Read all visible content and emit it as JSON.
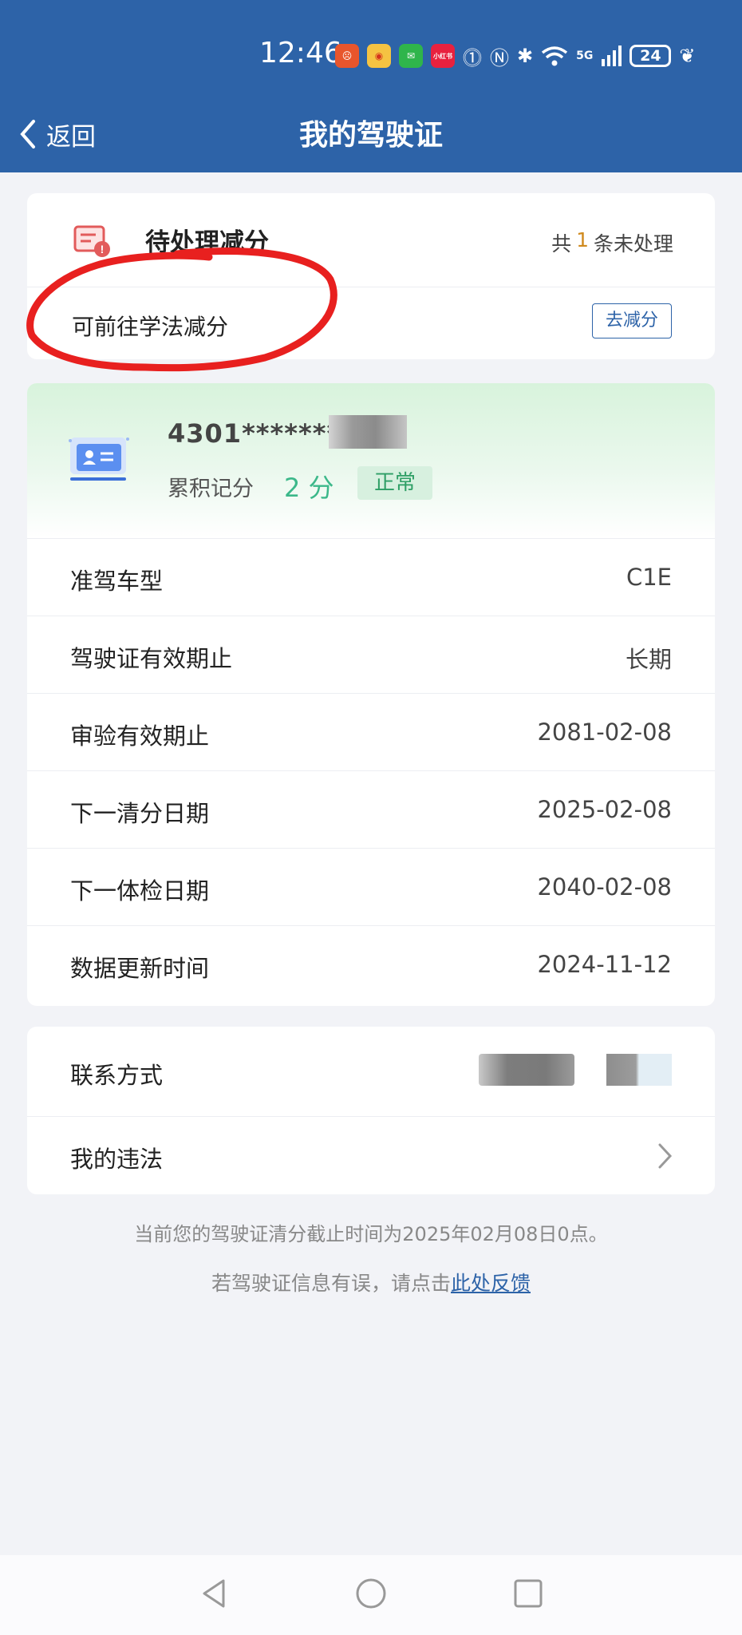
{
  "status_bar": {
    "time": "12:46",
    "app_icons": [
      "weather-app",
      "weibo-app",
      "wechat-app",
      "xiaohongshu-app"
    ],
    "xiaohongshu_text": "小红书",
    "indicators": [
      "hd-icon",
      "nfc-icon",
      "bluetooth-icon",
      "wifi-icon"
    ],
    "network": "5G",
    "battery": "24"
  },
  "nav": {
    "back_label": "返回",
    "title": "我的驾驶证"
  },
  "pending": {
    "title": "待处理减分",
    "summary_prefix": "共",
    "summary_count": "1",
    "summary_suffix": "条未处理",
    "hint": "可前往学法减分",
    "action_label": "去减分"
  },
  "license": {
    "number_masked": "4301********",
    "points_label": "累积记分",
    "points_value": "2 分",
    "status": "正常",
    "rows": [
      {
        "label": "准驾车型",
        "value": "C1E"
      },
      {
        "label": "驾驶证有效期止",
        "value": "长期"
      },
      {
        "label": "审验有效期止",
        "value": "2081-02-08"
      },
      {
        "label": "下一清分日期",
        "value": "2025-02-08"
      },
      {
        "label": "下一体检日期",
        "value": "2040-02-08"
      },
      {
        "label": "数据更新时间",
        "value": "2024-11-12"
      }
    ]
  },
  "contact": {
    "label": "联系方式",
    "violation_label": "我的违法"
  },
  "footer": {
    "note": "当前您的驾驶证清分截止时间为2025年02月08日0点。",
    "feedback_text": "若驾驶证信息有误，请点击",
    "feedback_link": "此处反馈"
  },
  "colors": {
    "header_bg": "#2d63a8",
    "accent": "#2d63a8",
    "points_green": "#3cb88a",
    "status_green": "#2e9e65",
    "pending_count": "#d08a1e",
    "annotation_red": "#e8201f"
  }
}
